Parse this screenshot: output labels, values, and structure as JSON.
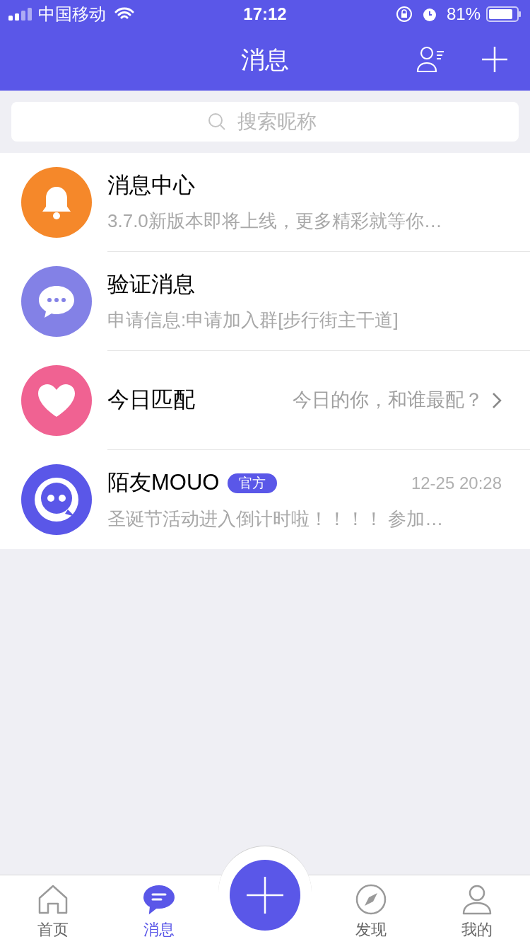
{
  "status_bar": {
    "carrier": "中国移动",
    "time": "17:12",
    "battery": "81%"
  },
  "nav": {
    "title": "消息"
  },
  "search": {
    "placeholder": "搜索昵称"
  },
  "conversations": [
    {
      "kind": "notice",
      "color": "#f5882a",
      "name": "消息中心",
      "preview": "3.7.0新版本即将上线，更多精彩就等你…"
    },
    {
      "kind": "verify",
      "color": "#8381e6",
      "name": "验证消息",
      "preview": "申请信息:申请加入群[步行街主干道]"
    },
    {
      "kind": "match",
      "color": "#f06292",
      "name": "今日匹配",
      "hint": "今日的你，和谁最配？"
    },
    {
      "kind": "official",
      "color": "#5a57e8",
      "name": "陌友MOUO",
      "badge": "官方",
      "time": "12-25 20:28",
      "preview": "圣诞节活动进入倒计时啦！！！！ 参加…"
    }
  ],
  "tabs": [
    {
      "kind": "home",
      "label": "首页",
      "selected": false
    },
    {
      "kind": "messages",
      "label": "消息",
      "selected": true
    },
    {
      "kind": "discover",
      "label": "发现",
      "selected": false
    },
    {
      "kind": "me",
      "label": "我的",
      "selected": false
    }
  ]
}
